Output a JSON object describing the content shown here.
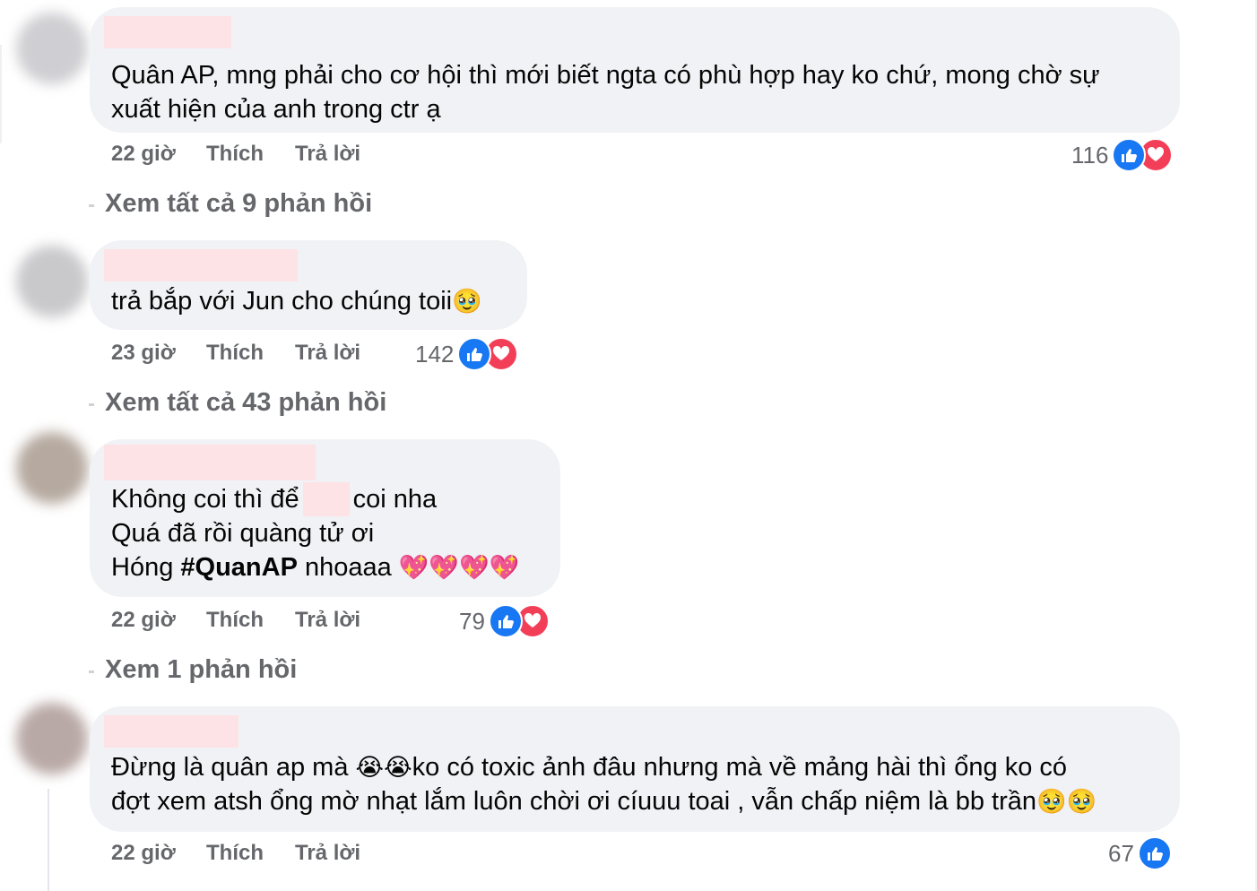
{
  "comments": [
    {
      "avatar_color": "#cfcfd3",
      "lines": [
        "Quân AP, mng phải cho cơ hội thì mới biết ngta có phù hợp hay ko chứ, mong chờ sự",
        "xuất hiện của anh trong ctr ạ"
      ],
      "time": "22 giờ",
      "like_label": "Thích",
      "reply_label": "Trả lời",
      "reaction_count": "116",
      "reactions": [
        "like-icon",
        "love-icon"
      ],
      "view_replies": "Xem tất cả 9 phản hồi"
    },
    {
      "avatar_color": "#c9c9cc",
      "lines": [
        "trả bắp với Jun cho chúng toii"
      ],
      "emoji": "🥹",
      "time": "23 giờ",
      "like_label": "Thích",
      "reply_label": "Trả lời",
      "reaction_count": "142",
      "reactions": [
        "like-icon",
        "love-icon"
      ],
      "view_replies": "Xem tất cả 43 phản hồi"
    },
    {
      "avatar_color": "#b6aaa0",
      "line1_a": "Không coi thì để",
      "line1_b": "coi nha",
      "line2": "Quá đã rồi quàng tử ơi",
      "line3_a": "Hóng ",
      "hashtag": "#QuanAP",
      "line3_b": " nhoaaa ",
      "emojis": "💖💖💖💖",
      "time": "22 giờ",
      "like_label": "Thích",
      "reply_label": "Trả lời",
      "reaction_count": "79",
      "reactions": [
        "like-icon",
        "love-icon"
      ],
      "view_replies": "Xem 1 phản hồi"
    },
    {
      "avatar_color": "#b9a9a6",
      "line1_a": "Đừng là quân ap mà ",
      "line1_emoji": "😭😭",
      "line1_b": "ko có toxic ảnh đâu nhưng mà về mảng hài thì ổng ko có",
      "line2_a": "đợt xem atsh ổng mờ nhạt lắm luôn chời ơi cíuuu toai , vẫn chấp niệm là bb trần",
      "line2_emoji": "🥹🥹",
      "time": "22 giờ",
      "like_label": "Thích",
      "reply_label": "Trả lời",
      "reaction_count": "67",
      "reactions": [
        "like-icon"
      ]
    }
  ],
  "colors": {
    "bubble": "#f0f2f5",
    "meta": "#65676b",
    "like": "#1877f2",
    "love": "#f33e58",
    "redaction": "#fde3e5"
  }
}
